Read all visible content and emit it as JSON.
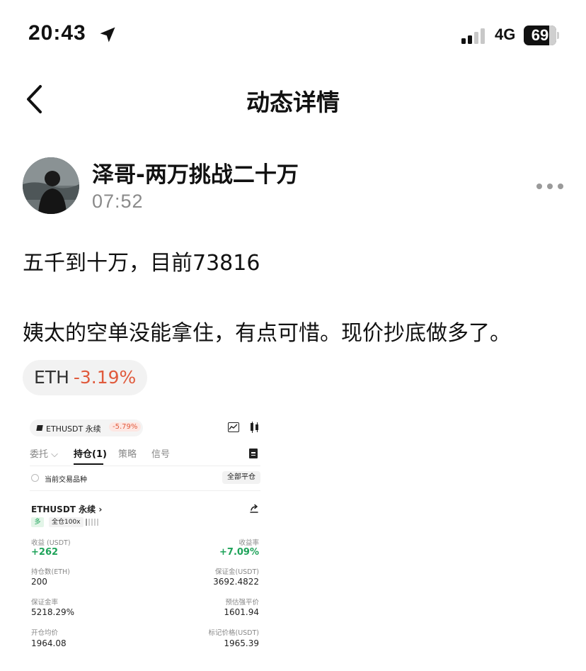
{
  "status_bar": {
    "time": "20:43",
    "network": "4G",
    "battery": "69",
    "battery_level": 0.69,
    "location_icon": "location-arrow-icon",
    "signal_bars_active": 2
  },
  "nav": {
    "title": "动态详情",
    "back_icon": "chevron-left-icon"
  },
  "post": {
    "author": "泽哥-两万挑战二十万",
    "time": "07:52",
    "line1": "五千到十万，目前73816",
    "line2": "姨太的空单没能拿住，有点可惜。现价抄底做多了。",
    "tag": {
      "symbol": "ETH",
      "change": "-3.19%"
    },
    "more_icon": "more-dots-icon"
  },
  "screenshot": {
    "pair": "ETHUSDT 永续",
    "pair_change": "-5.79%",
    "tabs": [
      {
        "label": "委托 ⌵"
      },
      {
        "label": "持仓(1)"
      },
      {
        "label": "策略"
      },
      {
        "label": "信号"
      }
    ],
    "active_tab": 1,
    "filter_label": "当前交易品种",
    "close_all": "全部平仓",
    "position": {
      "title": "ETHUSDT 永续 ›",
      "side_badge": "多",
      "leverage_badge": "全仓100x",
      "fields": [
        {
          "label": "收益 (USDT)",
          "value": "+262"
        },
        {
          "label": "收益率",
          "value": "+7.09%"
        },
        {
          "label": "持仓数(ETH)",
          "value": "200"
        },
        {
          "label": "保证金(USDT)",
          "value": "3692.4822"
        },
        {
          "label": "保证金率",
          "value": "5218.29%"
        },
        {
          "label": "预估强平价",
          "value": "1601.94"
        },
        {
          "label": "开仓均价",
          "value": "1964.08"
        },
        {
          "label": "标记价格(USDT)",
          "value": "1965.39"
        }
      ]
    },
    "colors": {
      "profit": "#1fa35a",
      "loss": "#e05a3c"
    }
  }
}
